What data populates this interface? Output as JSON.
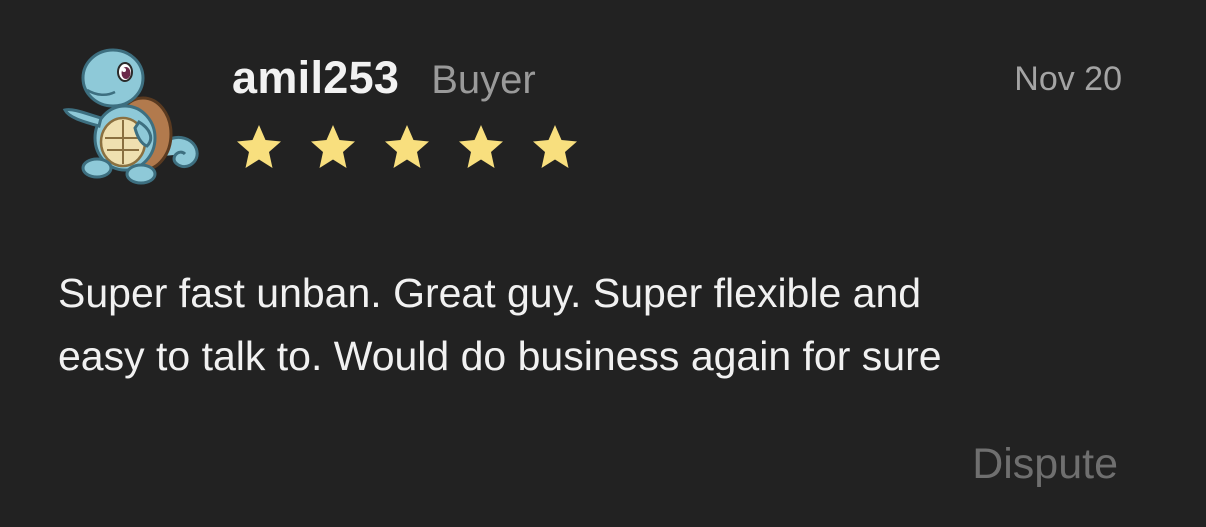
{
  "review": {
    "username": "amil253",
    "role": "Buyer",
    "date": "Nov 20",
    "rating": 5,
    "rating_max": 5,
    "text_line_1": "Super fast unban. Great guy. Super flexible and",
    "text_line_2": "easy to talk to. Would do business again for sure",
    "dispute_label": "Dispute",
    "avatar_icon": "squirtle-avatar-icon",
    "star_icon": "star-icon",
    "star_color": "#f8df7e",
    "background_color": "#222222"
  }
}
